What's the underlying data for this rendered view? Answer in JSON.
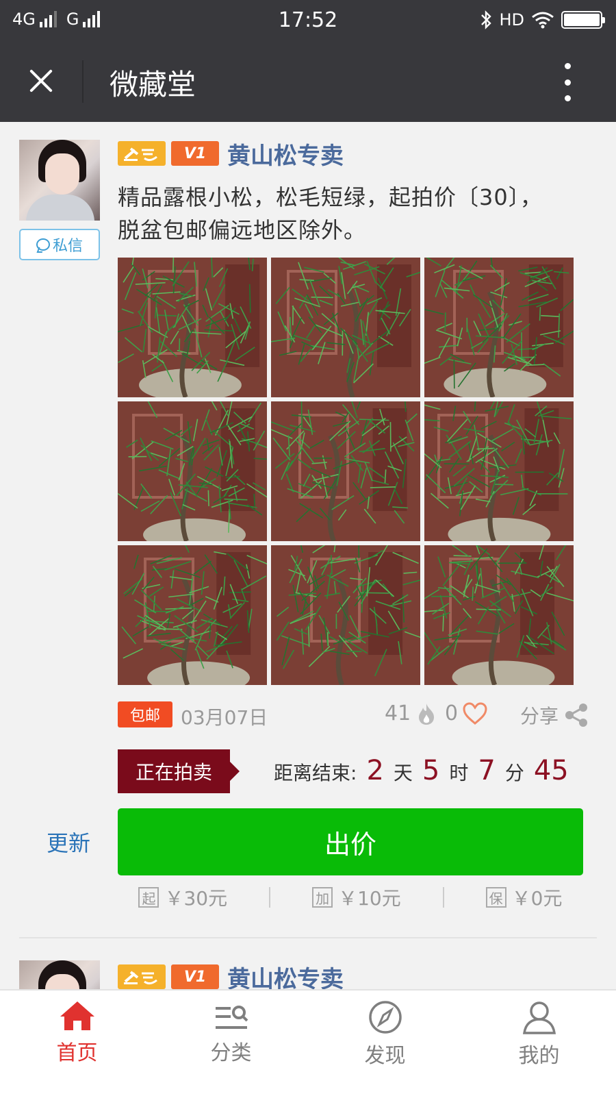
{
  "status_bar": {
    "network1": "4G",
    "network2": "G",
    "time": "17:52",
    "hd": "HD"
  },
  "title_bar": {
    "title": "微藏堂"
  },
  "post": {
    "shop_name": "黄山松专卖",
    "vip_badge": "V1",
    "private_message_label": "私信",
    "description": "精品露根小松，松毛短绿，起拍价〔30〕，脱盆包邮偏远地区除外。",
    "photo_count": 9,
    "free_shipping_badge": "包邮",
    "date": "03月07日",
    "views": "41",
    "likes": "0",
    "share_label": "分享",
    "auction_status": "正在拍卖",
    "countdown": {
      "label": "距离结束:",
      "days": "2",
      "days_unit": "天",
      "hours": "5",
      "hours_unit": "时",
      "minutes": "7",
      "minutes_unit": "分",
      "seconds": "45"
    },
    "refresh_label": "更新",
    "bid_button_label": "出价",
    "prices": [
      {
        "tag": "起",
        "value": "￥30元"
      },
      {
        "tag": "加",
        "value": "￥10元"
      },
      {
        "tag": "保",
        "value": "￥0元"
      }
    ]
  },
  "post2": {
    "shop_name": "黄山松专卖",
    "vip_badge": "V1"
  },
  "tab_bar": {
    "tabs": [
      {
        "label": "首页",
        "icon": "home-icon",
        "active": true
      },
      {
        "label": "分类",
        "icon": "category-search-icon",
        "active": false
      },
      {
        "label": "发现",
        "icon": "compass-icon",
        "active": false
      },
      {
        "label": "我的",
        "icon": "user-icon",
        "active": false
      }
    ]
  },
  "colors": {
    "header_bg": "#38383c",
    "shop_name": "#4b6a9c",
    "auction_status_bg": "#7a0b1b",
    "countdown_number": "#8c1123",
    "bid_button": "#09bb07",
    "free_shipping": "#f14c23",
    "active_tab": "#e0322f"
  }
}
